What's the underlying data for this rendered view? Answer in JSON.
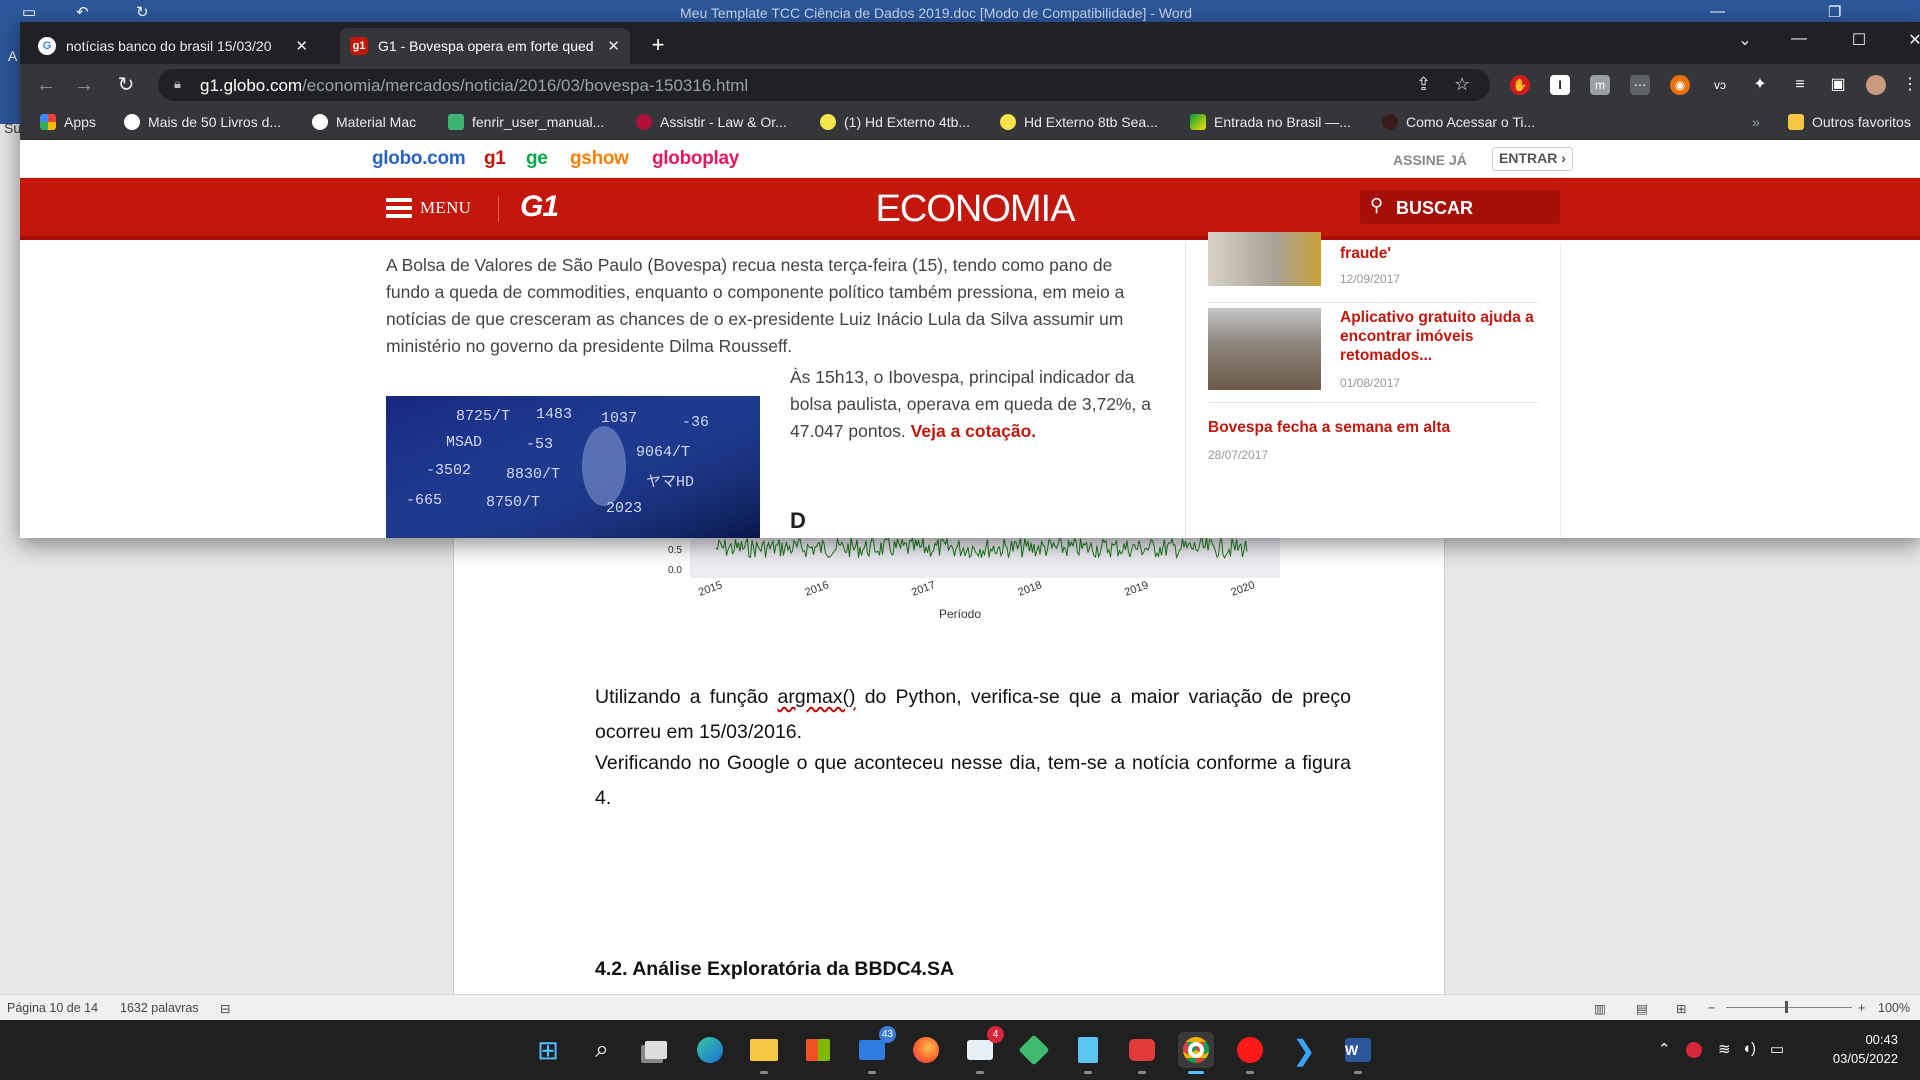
{
  "word": {
    "title": "Meu Template TCC Ciência de Dados 2019.doc [Modo de Compatibilidade] - Word",
    "ribbon_left_a": "A",
    "ribbon_left_su": "Su",
    "chart": {
      "x_label": "Período",
      "years": [
        "2015",
        "2016",
        "2017",
        "2018",
        "2019",
        "2020"
      ],
      "y_ticks": [
        "0.5",
        "0.0"
      ]
    },
    "paragraph1_before": "Utilizando a função ",
    "paragraph1_spell": "argmax()",
    "paragraph1_after": " do Python, verifica-se que a maior variação de preço ocorreu em 15/03/2016.",
    "paragraph2": "Verificando no Google o que aconteceu nesse dia, tem-se a notícia conforme a figura 4.",
    "heading": "4.2. Análise Exploratória da BBDC4.SA",
    "status": {
      "page": "Página 10 de 14",
      "words": "1632 palavras",
      "zoom_minus": "−",
      "zoom_plus": "+",
      "zoom": "100%"
    }
  },
  "chrome": {
    "tabs": [
      {
        "title": "notícias banco do brasil 15/03/20",
        "favicon": "G",
        "active": false
      },
      {
        "title": "G1 - Bovespa opera em forte qued",
        "favicon": "g1",
        "active": true
      }
    ],
    "url_host": "g1.globo.com",
    "url_path": "/economia/mercados/noticia/2016/03/bovespa-150316.html",
    "bookmarks": [
      "Apps",
      "Mais de 50 Livros d...",
      "Material Mac",
      "fenrir_user_manual...",
      "Assistir - Law & Or...",
      "(1) Hd Externo 4tb...",
      "Hd Externo 8tb Sea...",
      "Entrada no Brasil —...",
      "Como Acessar o Ti...",
      "Outros favoritos"
    ],
    "overflow": "»"
  },
  "globo": {
    "links": [
      "globo.com",
      "g1",
      "ge",
      "gshow",
      "globoplay"
    ],
    "assine": "ASSINE JÁ",
    "entrar": "ENTRAR ›",
    "menu": "MENU",
    "logo": "G1",
    "section": "ECONOMIA",
    "search": "BUSCAR"
  },
  "article": {
    "lead": "A Bolsa de Valores de São Paulo (Bovespa) recua nesta terça-feira (15), tendo como pano de fundo a queda de commodities, enquanto o componente político também pressiona, em meio a notícias de que cresceram as chances de o ex-presidente Luiz Inácio Lula da Silva assumir um ministério no governo da presidente Dilma Rousseff.",
    "side_text": "Às 15h13, o Ibovespa, principal indicador da bolsa paulista, operava em queda de 3,72%, a 47.047 pontos.",
    "side_link": "Veja a cotação.",
    "cut_heading": "D"
  },
  "related": [
    {
      "title": "fraude'",
      "date": "12/09/2017"
    },
    {
      "title": "Aplicativo gratuito ajuda a encontrar imóveis retomados...",
      "date": "01/08/2017"
    },
    {
      "title": "Bovespa fecha a semana em alta",
      "date": "28/07/2017"
    }
  ],
  "taskbar": {
    "mail_badge": "43",
    "outlook_badge": "4",
    "time": "00:43",
    "date": "03/05/2022"
  },
  "colors": {
    "g1_red": "#c4170c",
    "word_blue": "#2b579a",
    "chrome_dark": "#35363a"
  }
}
